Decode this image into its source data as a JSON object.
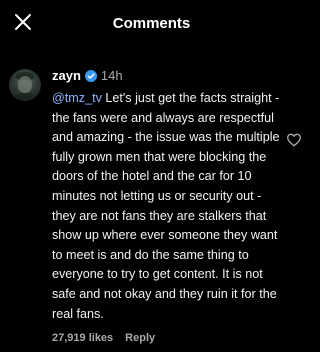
{
  "header": {
    "title": "Comments",
    "close_icon": "close-icon"
  },
  "comment": {
    "username": "zayn",
    "verified_icon": "verified-badge-icon",
    "verified_color": "#3897f0",
    "time": "14h",
    "mention": "@tmz_tv",
    "text": " Let's just get the facts straight - the fans were and always are respectful and amazing - the issue was the multiple fully grown men that were blocking the doors of the hotel and the car for 10 minutes not letting us or security out - they are not fans they are stalkers that show up where ever someone they want to meet is and do the same thing to everyone to try to get content. It is not safe and not okay and they ruin it for the real fans.",
    "likes": "27,919 likes",
    "reply_label": "Reply",
    "like_icon": "heart-outline-icon"
  },
  "colors": {
    "background": "#000000",
    "mention": "#8cb4ff",
    "secondary_text": "#a8a8a8"
  }
}
